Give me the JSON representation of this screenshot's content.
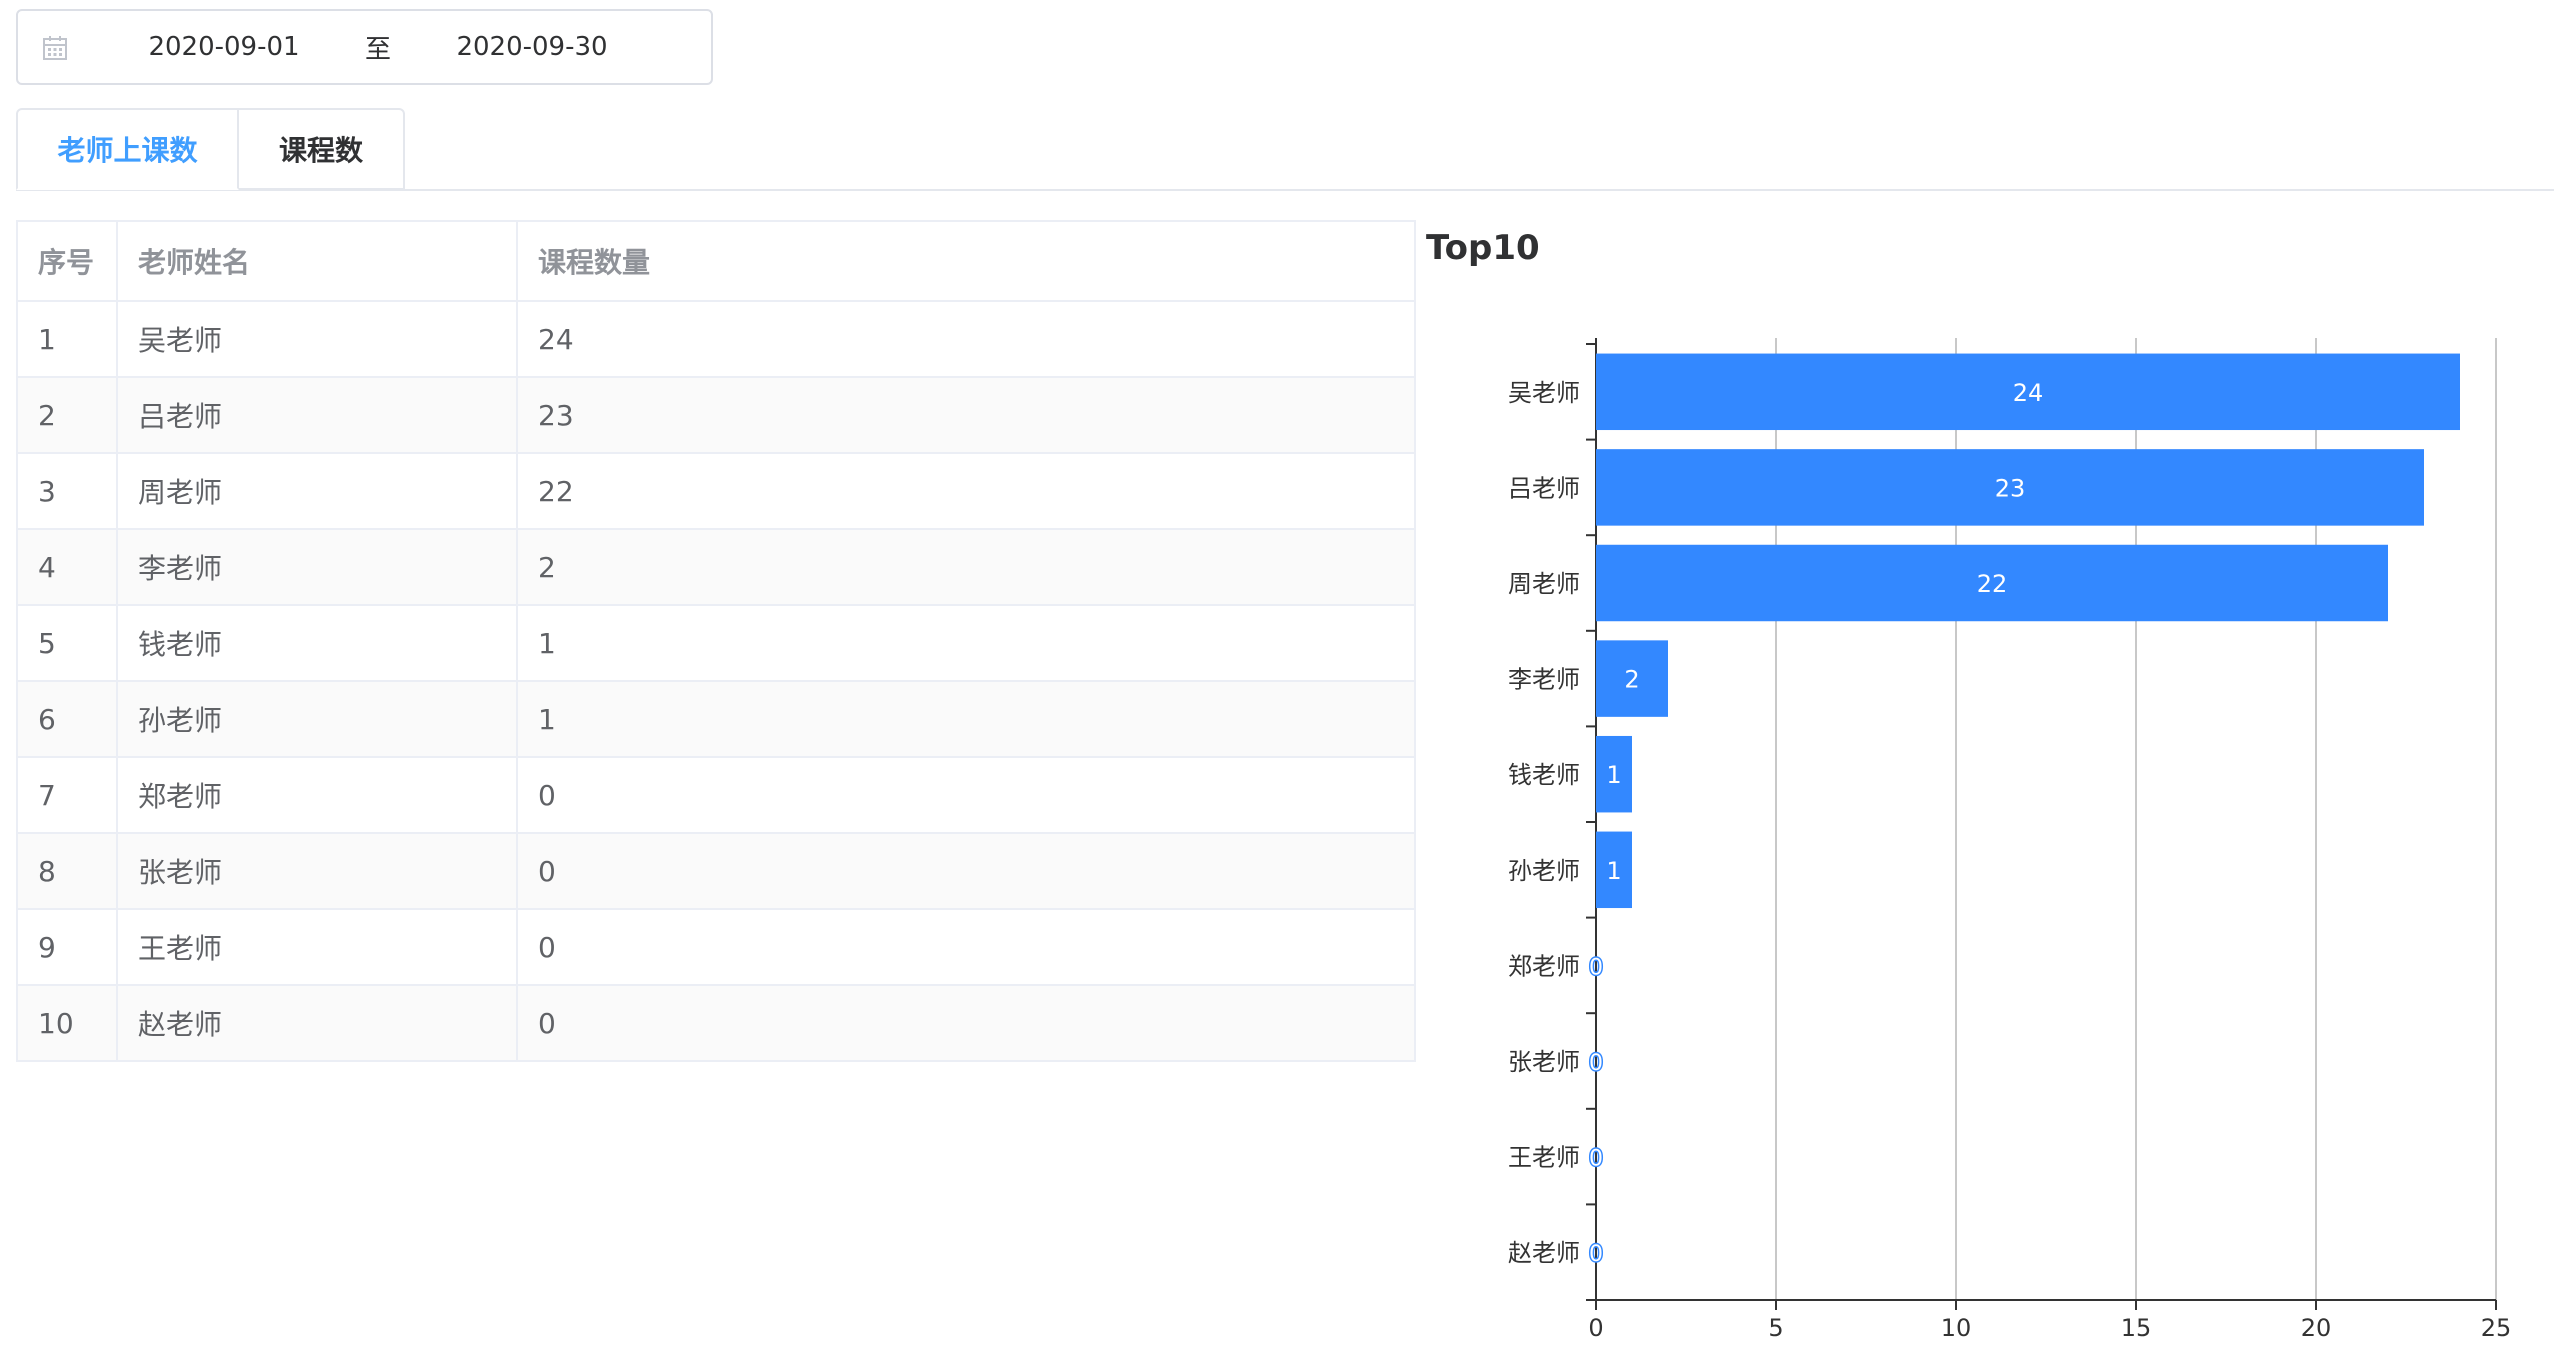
{
  "date_range": {
    "start": "2020-09-01",
    "separator": "至",
    "end": "2020-09-30",
    "icon": "calendar-icon"
  },
  "tabs": [
    {
      "label": "老师上课数",
      "active": true
    },
    {
      "label": "课程数",
      "active": false
    }
  ],
  "table": {
    "headers": [
      "序号",
      "老师姓名",
      "课程数量"
    ],
    "rows": [
      {
        "idx": "1",
        "name": "吴老师",
        "count": "24"
      },
      {
        "idx": "2",
        "name": "吕老师",
        "count": "23"
      },
      {
        "idx": "3",
        "name": "周老师",
        "count": "22"
      },
      {
        "idx": "4",
        "name": "李老师",
        "count": "2"
      },
      {
        "idx": "5",
        "name": "钱老师",
        "count": "1"
      },
      {
        "idx": "6",
        "name": "孙老师",
        "count": "1"
      },
      {
        "idx": "7",
        "name": "郑老师",
        "count": "0"
      },
      {
        "idx": "8",
        "name": "张老师",
        "count": "0"
      },
      {
        "idx": "9",
        "name": "王老师",
        "count": "0"
      },
      {
        "idx": "10",
        "name": "赵老师",
        "count": "0"
      }
    ]
  },
  "chart_data": {
    "type": "bar",
    "orientation": "horizontal",
    "title": "Top10",
    "categories": [
      "吴老师",
      "吕老师",
      "周老师",
      "李老师",
      "钱老师",
      "孙老师",
      "郑老师",
      "张老师",
      "王老师",
      "赵老师"
    ],
    "values": [
      24,
      23,
      22,
      2,
      1,
      1,
      0,
      0,
      0,
      0
    ],
    "xlim": [
      0,
      25
    ],
    "xticks": [
      0,
      5,
      10,
      15,
      20,
      25
    ],
    "grid": true,
    "color": "#3388ff"
  },
  "colors": {
    "accent": "#409eff",
    "bar": "#3388ff"
  }
}
